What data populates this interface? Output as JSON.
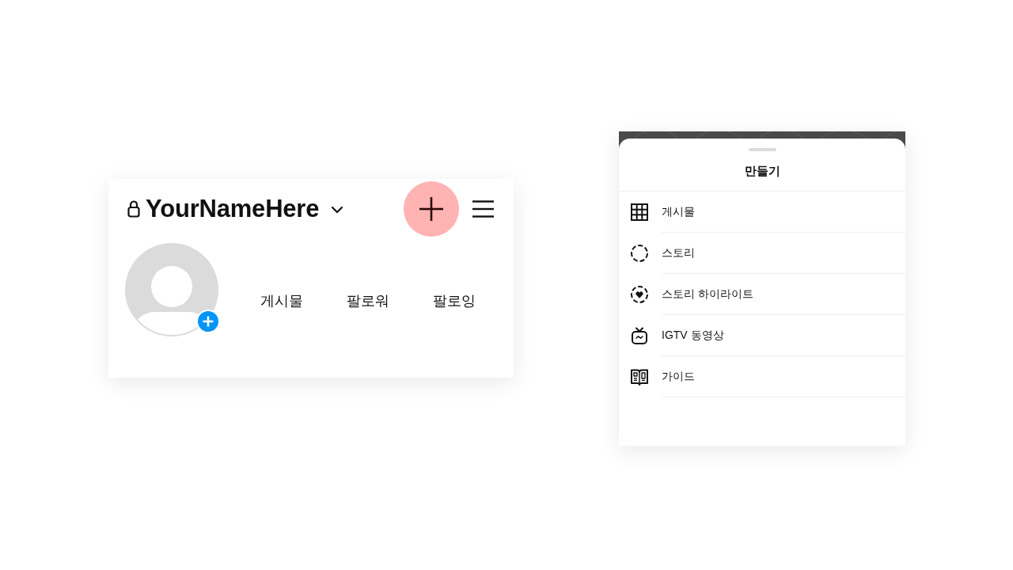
{
  "profile": {
    "private": true,
    "username": "YourNameHere",
    "stats": [
      "게시물",
      "팔로워",
      "팔로잉"
    ]
  },
  "create_button": {
    "highlighted": true
  },
  "create_sheet": {
    "title": "만들기",
    "items": [
      {
        "kind": "grid",
        "label": "게시물"
      },
      {
        "kind": "story",
        "label": "스토리"
      },
      {
        "kind": "highlight",
        "label": "스토리 하이라이트"
      },
      {
        "kind": "igtv",
        "label": "IGTV 동영상"
      },
      {
        "kind": "guide",
        "label": "가이드"
      }
    ]
  }
}
